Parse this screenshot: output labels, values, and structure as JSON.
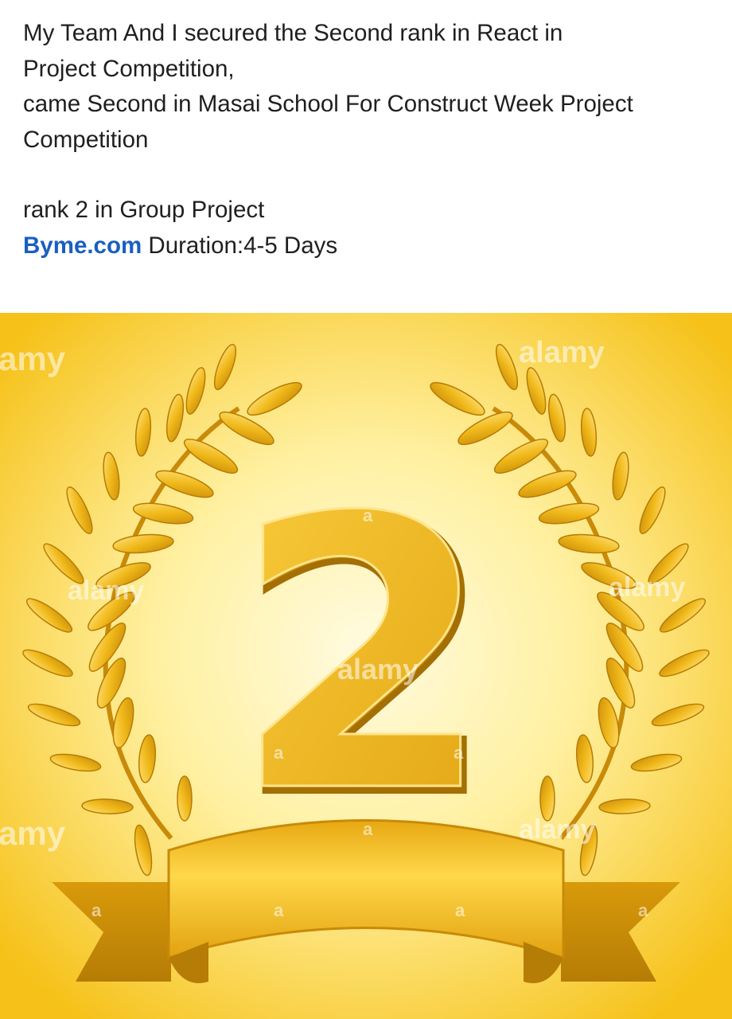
{
  "post": {
    "lines": [
      "My Team And I secured the Second rank in React in",
      "Project Competition,",
      "came Second in Masai School For Construct Week Project",
      "Competition"
    ],
    "rank_line": "rank 2 in Group Project",
    "link_text": "Byme.com",
    "duration_text": " Duration:4-5 Days"
  },
  "image": {
    "number": "2",
    "watermark_word": "alamy",
    "watermark_partial": "amy",
    "watermark_letter": "a",
    "colors": {
      "center_glow": "#fffbe0",
      "outer_glow": "#f6c21a",
      "gold_light": "#ffe27a",
      "gold_mid": "#f0b81a",
      "gold_dark": "#b57c06"
    }
  }
}
